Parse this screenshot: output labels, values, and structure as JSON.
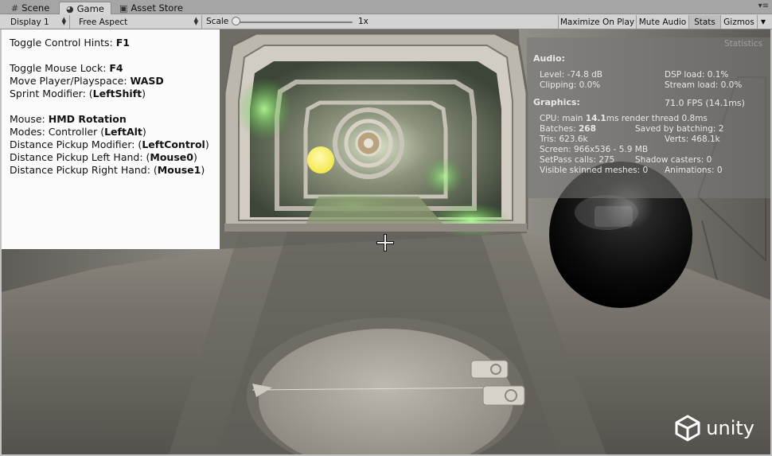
{
  "tabs": [
    {
      "label": "Scene",
      "icon": "hash-icon"
    },
    {
      "label": "Game",
      "icon": "pacman-icon"
    },
    {
      "label": "Asset Store",
      "icon": "store-icon"
    }
  ],
  "toolbar": {
    "display": "Display 1",
    "aspect": "Free Aspect",
    "scale_label": "Scale",
    "scale_value": "1x",
    "maximize": "Maximize On Play",
    "mute": "Mute Audio",
    "stats": "Stats",
    "gizmos": "Gizmos"
  },
  "hints": {
    "l1_text": "Toggle Control Hints: ",
    "l1_key": "F1",
    "l2_text": "Toggle Mouse Lock: ",
    "l2_key": "F4",
    "l3_text": "Move Player/Playspace: ",
    "l3_key": "WASD",
    "l4_text": "Sprint Modifier: (",
    "l4_key": "LeftShift",
    "l4_end": ")",
    "l5_text": "Mouse: ",
    "l5_key": "HMD Rotation",
    "l6_text": "Modes: Controller (",
    "l6_key": "LeftAlt",
    "l6_end": ")",
    "l7_text": "Distance Pickup Modifier: (",
    "l7_key": "LeftControl",
    "l7_end": ")",
    "l8_text": "Distance Pickup Left Hand: (",
    "l8_key": "Mouse0",
    "l8_end": ")",
    "l9_text": "Distance Pickup Right Hand: (",
    "l9_key": "Mouse1",
    "l9_end": ")"
  },
  "stats": {
    "title": "Statistics",
    "audio_header": "Audio:",
    "level": "Level: -74.8 dB",
    "dsp": "DSP load: 0.1%",
    "clipping": "Clipping: 0.0%",
    "stream": "Stream load: 0.0%",
    "graphics_header": "Graphics:",
    "fps": "71.0 FPS (14.1ms)",
    "cpu_pre": "CPU: main ",
    "cpu_val": "14.1",
    "cpu_post": "ms  render thread 0.8ms",
    "batches_pre": "Batches: ",
    "batches_val": "268",
    "saved": "Saved by batching: 2",
    "tris": "Tris: 623.6k",
    "verts": "Verts: 468.1k",
    "screen": "Screen: 966x536 - 5.9 MB",
    "setpass": "SetPass calls: 275",
    "shadow": "Shadow casters: 0",
    "skinned": "Visible skinned meshes: 0",
    "animations": "Animations: 0"
  },
  "brand": {
    "logo_text": "unity"
  },
  "colors": {
    "hint_bg": "#fbfbfb",
    "stats_bg": "#787876",
    "toolbar_bg": "#d3d3d3",
    "glow_green": "#8ef07a",
    "sphere_yellow": "#fff27a"
  }
}
